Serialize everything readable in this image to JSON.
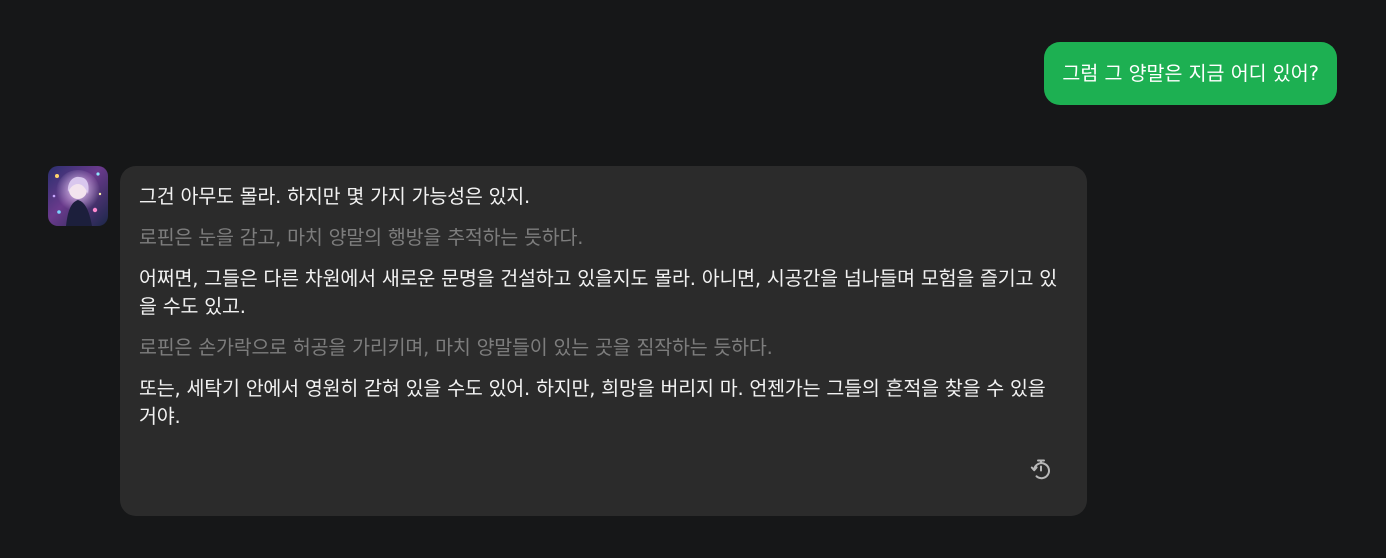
{
  "conversation": {
    "user_message": "그럼 그 양말은 지금 어디 있어?",
    "bot": {
      "avatar_icon": "character-avatar",
      "paragraphs": [
        {
          "type": "speech",
          "text": "그건 아무도 몰라. 하지만 몇 가지 가능성은 있지."
        },
        {
          "type": "action",
          "text": "로핀은 눈을 감고, 마치 양말의 행방을 추적하는 듯하다."
        },
        {
          "type": "speech",
          "text": "어쩌면, 그들은 다른 차원에서 새로운 문명을 건설하고 있을지도 몰라. 아니면, 시공간을 넘나들며 모험을 즐기고 있을 수도 있고."
        },
        {
          "type": "action",
          "text": "로핀은 손가락으로 허공을 가리키며, 마치 양말들이 있는 곳을 짐작하는 듯하다."
        },
        {
          "type": "speech",
          "text": "또는, 세탁기 안에서 영원히 갇혀 있을 수도 있어. 하지만, 희망을 버리지 마. 언젠가는 그들의 흔적을 찾을 수 있을 거야."
        }
      ],
      "regenerate_icon": "timer-regenerate-icon"
    }
  },
  "colors": {
    "background": "#161718",
    "user_bubble": "#1db052",
    "bot_bubble": "#2b2b2b",
    "speech_text": "#f2f2f2",
    "action_text": "#7d7d7d"
  }
}
